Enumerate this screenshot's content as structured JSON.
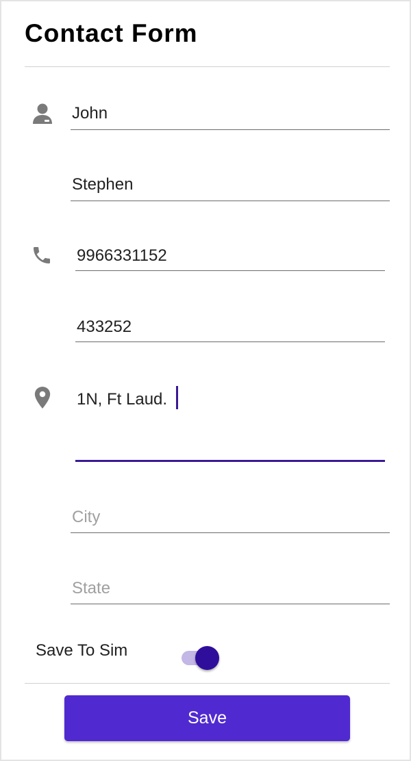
{
  "title": "Contact Form",
  "fields": {
    "first_name": {
      "value": "John",
      "placeholder": ""
    },
    "last_name": {
      "value": "Stephen",
      "placeholder": ""
    },
    "phone": {
      "value": "9966331152",
      "placeholder": ""
    },
    "phone_ext": {
      "value": "433252",
      "placeholder": ""
    },
    "address": {
      "value": "1N, Ft Laud.",
      "placeholder": ""
    },
    "city": {
      "value": "",
      "placeholder": "City"
    },
    "state": {
      "value": "",
      "placeholder": "State"
    }
  },
  "icons": {
    "person": "person-icon",
    "phone": "phone-icon",
    "location": "location-pin-icon"
  },
  "save_to_sim": {
    "label": "Save To Sim",
    "checked": true
  },
  "save_button": {
    "label": "Save"
  },
  "colors": {
    "accent": "#502ad0",
    "active_underline": "#3a1a96",
    "switch_thumb": "#2f0e9c",
    "switch_track": "#c3b7e6",
    "icon": "#7a7a7a"
  }
}
